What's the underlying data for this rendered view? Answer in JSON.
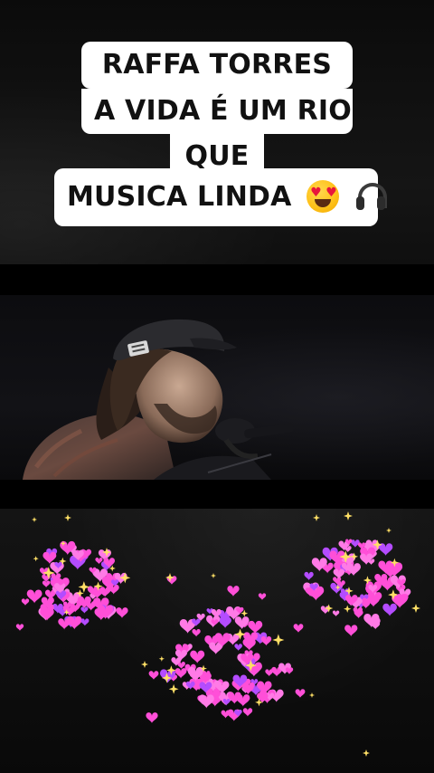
{
  "caption": {
    "line1": "RAFFA TORRES",
    "line2": "A VIDA É UM RIO",
    "line3": "QUE",
    "line4": "MUSICA LINDA"
  },
  "icons": {
    "emoji1": "smiling-face-with-heart-eyes-icon",
    "emoji2": "headphones-icon"
  },
  "colors": {
    "caption_bg": "#ffffff",
    "caption_text": "#111111",
    "heart_pink": "#ff4fd8",
    "sparkle_gold": "#ffe066"
  }
}
